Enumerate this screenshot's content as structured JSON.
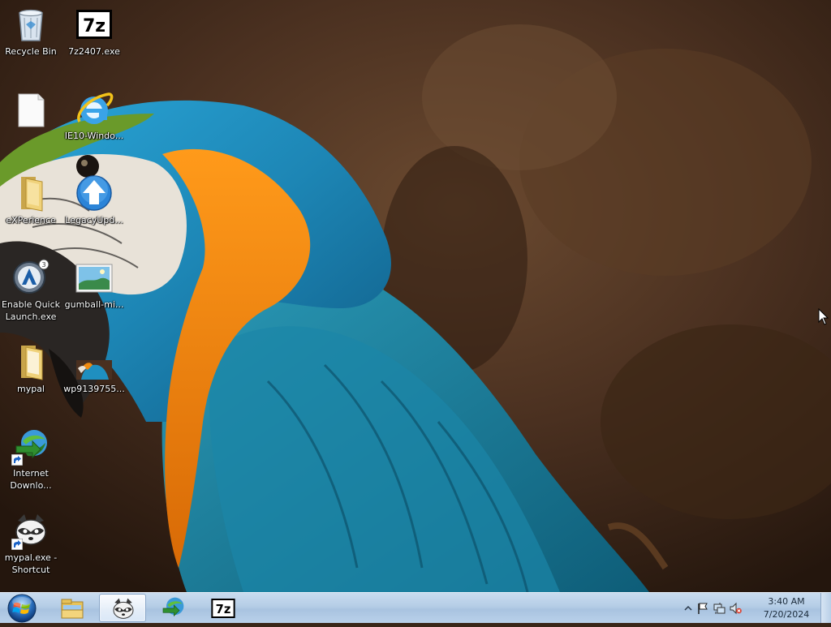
{
  "desktop": {
    "icons": [
      {
        "label": "Recycle Bin",
        "icon": "recycle-bin-icon"
      },
      {
        "label": "7z2407.exe",
        "icon": "7zip-icon"
      },
      {
        "label": "",
        "icon": "blank-file-icon"
      },
      {
        "label": "IE10-Windo...",
        "icon": "internet-explorer-icon"
      },
      {
        "label": "eXPerience",
        "icon": "folder-icon"
      },
      {
        "label": "LegacyUpd...",
        "icon": "legacy-update-icon"
      },
      {
        "label": "Enable Quick Launch.exe",
        "icon": "autoit-icon"
      },
      {
        "label": "gumball-mi...",
        "icon": "image-file-icon"
      },
      {
        "label": "mypal",
        "icon": "folder-icon"
      },
      {
        "label": "wp9139755...",
        "icon": "image-thumbnail-icon"
      },
      {
        "label": "Internet Downlo...",
        "icon": "internet-download-manager-icon"
      },
      {
        "label": "mypal.exe - Shortcut",
        "icon": "mypal-raccoon-icon"
      }
    ]
  },
  "taskbar": {
    "start": "start-orb-icon",
    "pinned": [
      {
        "name": "Windows Explorer",
        "icon": "explorer-folder-icon",
        "active": false
      },
      {
        "name": "Mypal",
        "icon": "mypal-raccoon-icon",
        "active": true
      },
      {
        "name": "Internet Download Manager",
        "icon": "internet-download-manager-icon",
        "active": false
      },
      {
        "name": "7-Zip",
        "icon": "7zip-icon",
        "active": false
      }
    ],
    "tray": {
      "icons": [
        "show-hidden-icons-chevron",
        "action-center-flag-icon",
        "network-icon",
        "volume-muted-icon"
      ],
      "time": "3:40 AM",
      "date": "7/20/2024"
    }
  },
  "colors": {
    "taskbar": "#b5cde6",
    "wallpaper_bg": "#3a2618",
    "parrot_blue": "#1e8fc0",
    "parrot_orange": "#f08a10"
  }
}
